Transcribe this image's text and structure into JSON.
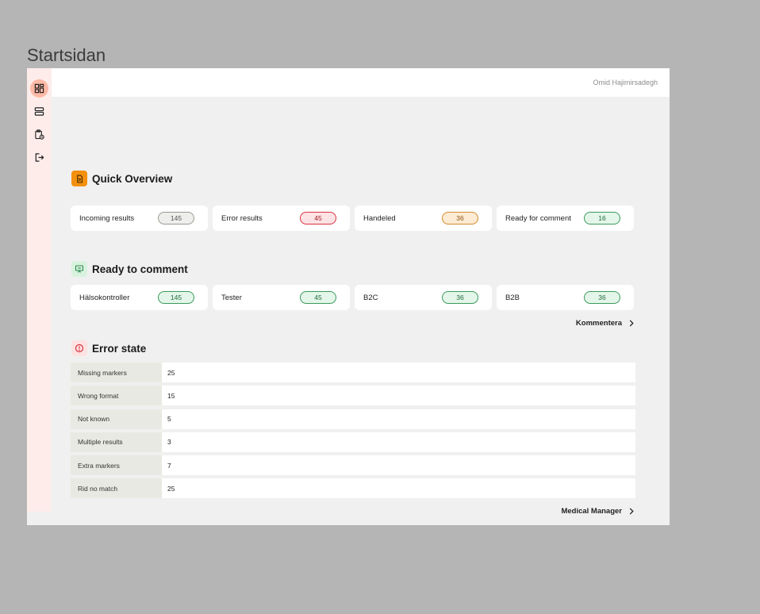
{
  "page": {
    "label": "Startsidan"
  },
  "header": {
    "user_name": "Omid Hajimirsadegh"
  },
  "sidebar": {
    "items": [
      {
        "icon": "dashboard-icon",
        "active": true
      },
      {
        "icon": "server-icon",
        "active": false
      },
      {
        "icon": "clipboard-clock-icon",
        "active": false
      },
      {
        "icon": "logout-icon",
        "active": false
      }
    ]
  },
  "quick_overview": {
    "title": "Quick Overview",
    "icon": "document-icon",
    "cards": [
      {
        "label": "Incoming results",
        "value": "145",
        "status": "neutral"
      },
      {
        "label": "Error results",
        "value": "45",
        "status": "error"
      },
      {
        "label": "Handeled",
        "value": "36",
        "status": "warn"
      },
      {
        "label": "Ready for comment",
        "value": "16",
        "status": "ok"
      }
    ]
  },
  "ready_to_comment": {
    "title": "Ready to comment",
    "icon": "presentation-icon",
    "cards": [
      {
        "label": "Hälsokontroller",
        "value": "145",
        "status": "ok"
      },
      {
        "label": "Tester",
        "value": "45",
        "status": "ok"
      },
      {
        "label": "B2C",
        "value": "36",
        "status": "ok"
      },
      {
        "label": "B2B",
        "value": "36",
        "status": "ok"
      }
    ],
    "link_label": "Kommentera"
  },
  "error_state": {
    "title": "Error state",
    "icon": "alert-circle-icon",
    "rows": [
      {
        "label": "Missing markers",
        "value": "25"
      },
      {
        "label": "Wrong format",
        "value": "15"
      },
      {
        "label": "Not known",
        "value": "5"
      },
      {
        "label": "Multiple results",
        "value": "3"
      },
      {
        "label": "Extra markers",
        "value": "7"
      },
      {
        "label": "Rid no match",
        "value": "25"
      }
    ],
    "link_label": "Medical Manager"
  },
  "colors": {
    "accent_orange": "#f3900f",
    "sidebar_bg": "#fdecea",
    "active_nav": "#ffb9a6",
    "error": "#d8323f",
    "ok": "#3a9a5c",
    "warn": "#d48b2b"
  }
}
